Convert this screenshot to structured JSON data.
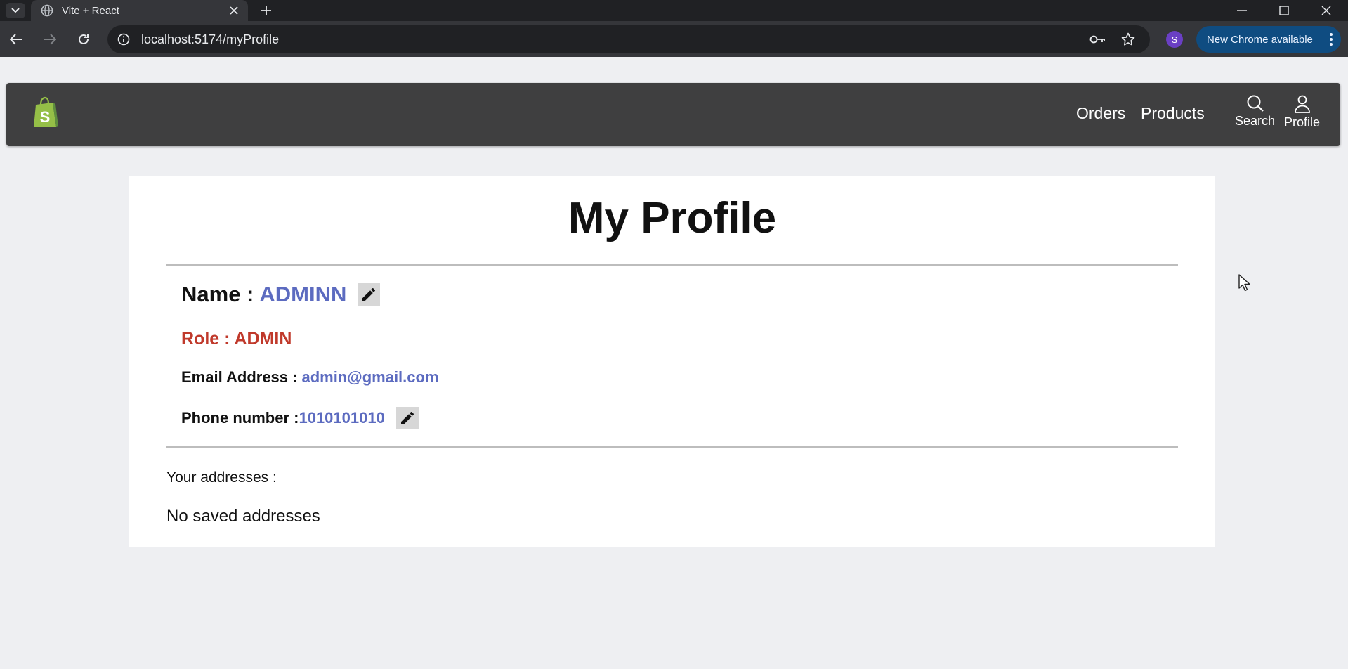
{
  "browser": {
    "tab_title": "Vite + React",
    "url": "localhost:5174/myProfile",
    "profile_initial": "S",
    "update_label": "New Chrome available",
    "accent_update": "#0f4c81",
    "icons": [
      "chevron-down-icon",
      "globe-icon",
      "close-icon",
      "plus-icon",
      "minimize-icon",
      "maximize-icon",
      "back-icon",
      "forward-icon",
      "reload-icon",
      "info-icon",
      "key-icon",
      "star-icon",
      "more-vert-icon"
    ]
  },
  "navbar": {
    "background": "#3f3f40",
    "links": {
      "orders": "Orders",
      "products": "Products",
      "search": "Search",
      "profile": "Profile"
    }
  },
  "profile": {
    "title": "My Profile",
    "name_label": "Name : ",
    "name_value": "ADMINN",
    "role_text": "Role : ADMIN",
    "email_label": "Email Address : ",
    "email_value": "admin@gmail.com",
    "phone_label": "Phone number :",
    "phone_value": "1010101010",
    "addresses_label": "Your addresses :",
    "addresses_empty": "No saved addresses",
    "colors": {
      "value": "#5c6bc0",
      "role": "#c0392b"
    }
  }
}
